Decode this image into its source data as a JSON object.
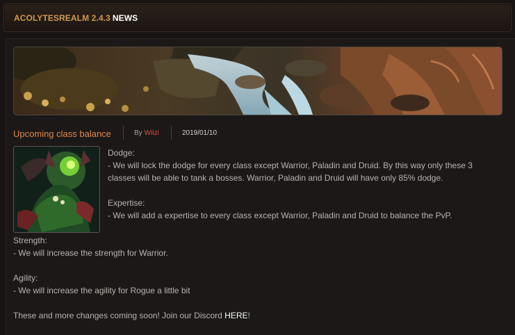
{
  "header": {
    "title_main": "ACOLYTESREALM 2.4.3",
    "title_accent": "NEWS"
  },
  "post": {
    "title": "Upcoming class balance",
    "by_label": "By",
    "author": "Wiizi",
    "date": "2019/01/10",
    "dodge_heading": "Dodge:",
    "dodge_line1": "- We will lock the dodge for every class except Warrior, Paladin and Druid. By this way only these 3",
    "dodge_line2": "classes will be able to tank a bosses. Warrior, Paladin and Druid will have only 85% dodge.",
    "expertise_heading": "Expertise:",
    "expertise_line1": "- We will add a expertise to every class except Warrior, Paladin and Druid to balance the PvP.",
    "strength_heading": "Strength:",
    "strength_line1": "- We will increase the strength for Warrior.",
    "agility_heading": "Agility:",
    "agility_line1": "- We will increase the agility for Rogue a little bit",
    "closing_text": "These and more changes coming soon! Join our Discord ",
    "closing_link": "HERE",
    "closing_end": "!"
  },
  "colors": {
    "header_gold": "#d09a4e",
    "post_title": "#e08a4c",
    "author": "#e0523e",
    "body_text": "#b8b4b0"
  }
}
